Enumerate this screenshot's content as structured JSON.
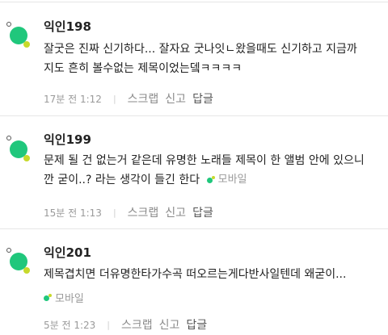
{
  "comments": [
    {
      "author": "익인198",
      "lines": [
        "잘굿은 진짜 신기하다... 잘자요 굿나잇ㄴ왔을때도 신기하고 지금까",
        "지도 흔히 볼수없는 제목이었는뎈ㅋㅋㅋㅋ"
      ],
      "mobile": "",
      "time": "17분 전 1:12",
      "scrap": "스크랩",
      "report": "신고",
      "reply": "답글"
    },
    {
      "author": "익인199",
      "lines": [
        "문제 될 건 없는거 같은데 유명한 노래들 제목이 한 앨범 안에 있으니",
        "깐 굳이..? 라는 생각이 들긴 한다"
      ],
      "mobile": "모바일",
      "time": "15분 전 1:13",
      "scrap": "스크랩",
      "report": "신고",
      "reply": "답글"
    },
    {
      "author": "익인201",
      "lines": [
        "제목겹치면 더유명한타가수곡 떠오르는게다반사일텐데 왜굳이..."
      ],
      "mobile": "모바일",
      "time": "5분 전 1:23",
      "scrap": "스크랩",
      "report": "신고",
      "reply": "답글"
    }
  ],
  "colors": {
    "avatar_green": "#20c77c",
    "avatar_yellow": "#c7d92b",
    "meta_gray": "#9a9a9a"
  },
  "icons": {
    "avatar": "avatar-icon",
    "mobile": "mobile-dot-icon"
  }
}
